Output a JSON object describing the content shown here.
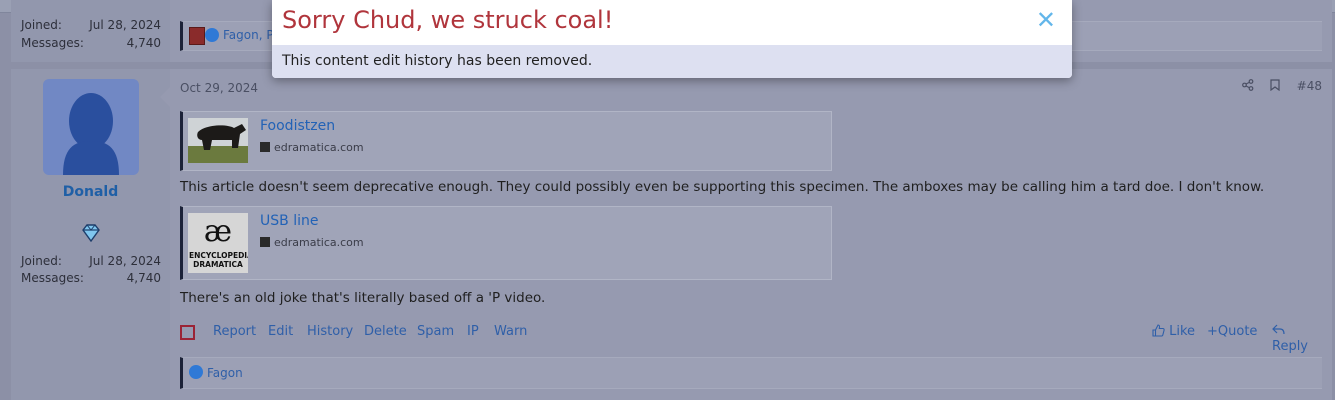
{
  "previous_post": {
    "stats": [
      {
        "label": "Joined:",
        "value": "Jul 28, 2024"
      },
      {
        "label": "Messages:",
        "value": "4,740"
      }
    ],
    "reactions_text": "Fagon, Pe"
  },
  "post": {
    "author": {
      "username": "Donald",
      "stats": [
        {
          "label": "Joined:",
          "value": "Jul 28, 2024"
        },
        {
          "label": "Messages:",
          "value": "4,740"
        }
      ]
    },
    "date": "Oct 29, 2024",
    "number": "#48",
    "embeds": [
      {
        "title": "Foodistzen",
        "site": "edramatica.com"
      },
      {
        "title": "USB line",
        "site": "edramatica.com",
        "logo_text": "ENCYCLOPEDIA DRAMATICA",
        "logo_glyph": "æ"
      }
    ],
    "paragraphs": [
      "This article doesn't seem deprecative enough. They could possibly even be supporting this specimen. The amboxes may be calling him a tard doe. I don't know.",
      "There's an old joke that's literally based off a 'P video."
    ],
    "actions_left": [
      "Report",
      "Edit",
      "History",
      "Delete",
      "Spam",
      "IP",
      "Warn"
    ],
    "actions_right": [
      "Like",
      "Quote",
      "Reply"
    ],
    "reactions": "Fagon"
  },
  "modal": {
    "title": "Sorry Chud, we struck coal!",
    "message": "This content edit history has been removed.",
    "close_symbol": "✕"
  },
  "colors": {
    "accent": "#2f5fa8",
    "modal_title": "#b0353c",
    "close": "#63b6ea"
  }
}
